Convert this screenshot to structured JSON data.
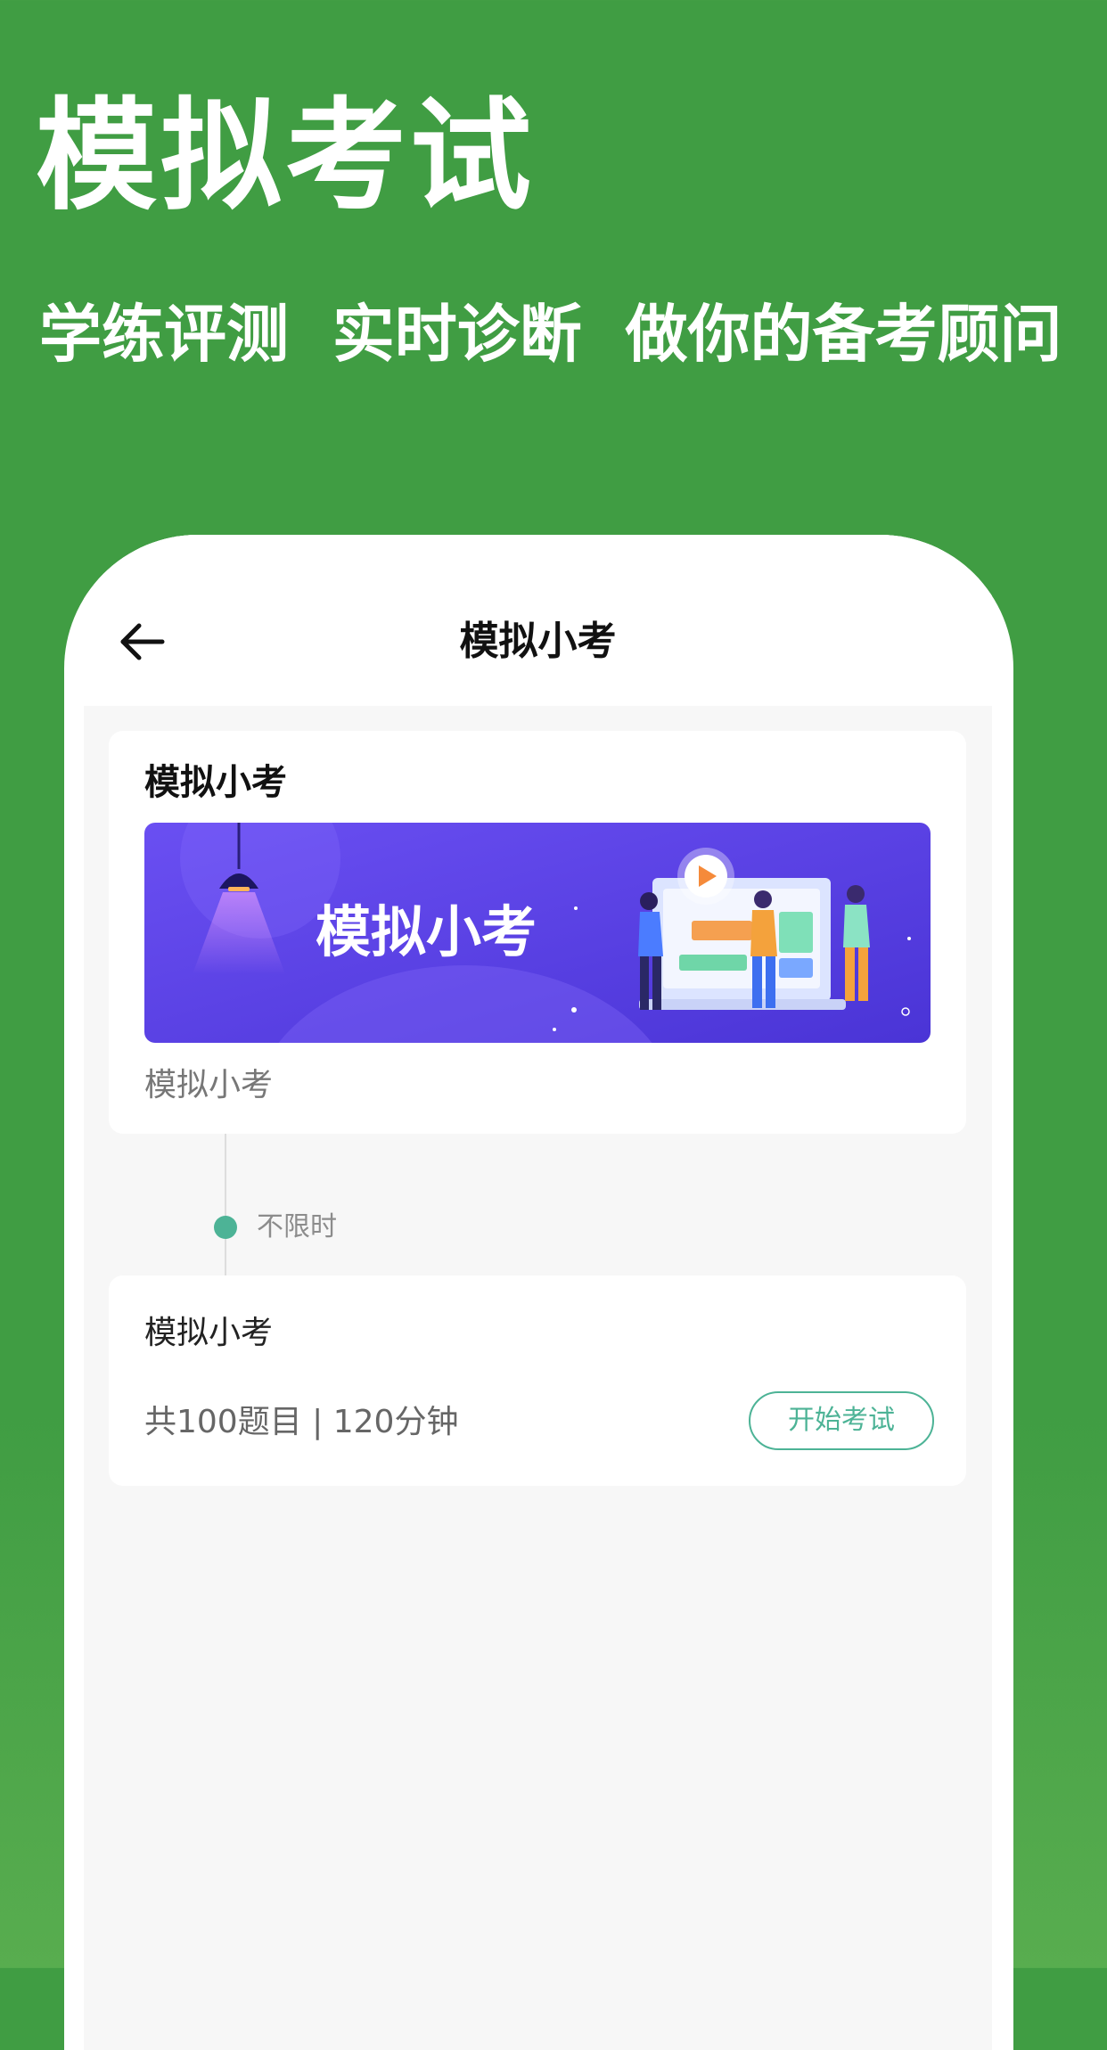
{
  "promo": {
    "title": "模拟考试",
    "subtitle": "学练评测  实时诊断  做你的备考顾问"
  },
  "header": {
    "back_icon": "arrow-left-icon",
    "title": "模拟小考"
  },
  "info_card": {
    "title": "模拟小考",
    "banner_text": "模拟小考",
    "description": "模拟小考"
  },
  "timeline": {
    "label": "不限时"
  },
  "exam_card": {
    "title": "模拟小考",
    "meta": "共100题目 | 120分钟",
    "start_label": "开始考试"
  },
  "colors": {
    "background": "#409d43",
    "accent": "#4db396",
    "banner": "#5b3fe0"
  }
}
